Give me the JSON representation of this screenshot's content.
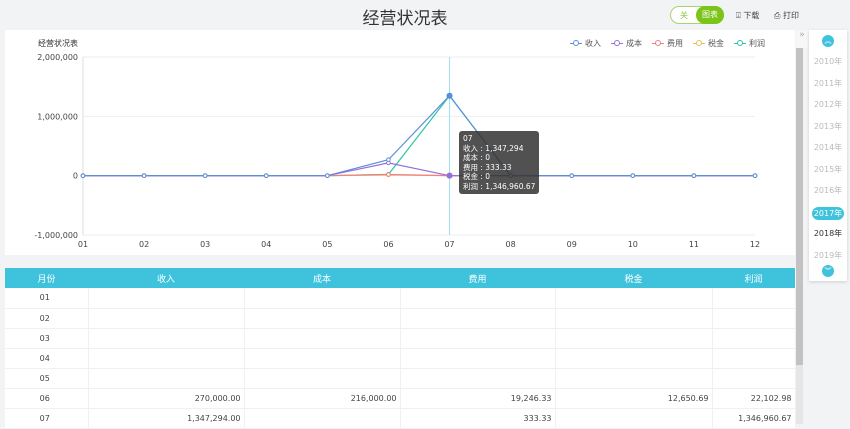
{
  "header": {
    "title": "经营状况表",
    "toggle_off": "关",
    "toggle_on": "图表",
    "download": "下载",
    "print": "打印",
    "download_icon": "download-icon",
    "print_icon": "printer-icon"
  },
  "chart_data": {
    "type": "line",
    "title": "经营状况表",
    "categories": [
      "01",
      "02",
      "03",
      "04",
      "05",
      "06",
      "07",
      "08",
      "09",
      "10",
      "11",
      "12"
    ],
    "ylim": [
      -1000000,
      2000000
    ],
    "yticks": [
      "2,000,000",
      "1,000,000",
      "0",
      "-1,000,000"
    ],
    "series": [
      {
        "name": "收入",
        "color": "#5b8fd9",
        "values": [
          0,
          0,
          0,
          0,
          0,
          270000,
          1347294,
          0,
          0,
          0,
          0,
          0
        ]
      },
      {
        "name": "成本",
        "color": "#9370db",
        "values": [
          0,
          0,
          0,
          0,
          0,
          216000,
          0,
          0,
          0,
          0,
          0,
          0
        ]
      },
      {
        "name": "费用",
        "color": "#f08080",
        "values": [
          0,
          0,
          0,
          0,
          0,
          19246.33,
          333.33,
          0,
          0,
          0,
          0,
          0
        ]
      },
      {
        "name": "税金",
        "color": "#e6c15a",
        "values": [
          0,
          0,
          0,
          0,
          0,
          12650.69,
          0,
          0,
          0,
          0,
          0,
          0
        ]
      },
      {
        "name": "利润",
        "color": "#2ec4a6",
        "values": [
          0,
          0,
          0,
          0,
          0,
          22102.98,
          1346960.67,
          0,
          0,
          0,
          0,
          0
        ]
      }
    ],
    "tooltip": {
      "title": "07",
      "lines": [
        "收入 : 1,347,294",
        "成本 : 0",
        "费用 : 333.33",
        "税金 : 0",
        "利润 : 1,346,960.67"
      ]
    }
  },
  "table": {
    "headers": [
      "月份",
      "收入",
      "成本",
      "费用",
      "税金",
      "利润"
    ],
    "rows": [
      [
        "01",
        "",
        "",
        "",
        "",
        ""
      ],
      [
        "02",
        "",
        "",
        "",
        "",
        ""
      ],
      [
        "03",
        "",
        "",
        "",
        "",
        ""
      ],
      [
        "04",
        "",
        "",
        "",
        "",
        ""
      ],
      [
        "05",
        "",
        "",
        "",
        "",
        ""
      ],
      [
        "06",
        "270,000.00",
        "216,000.00",
        "19,246.33",
        "12,650.69",
        "22,102.98"
      ],
      [
        "07",
        "1,347,294.00",
        "",
        "333.33",
        "",
        "1,346,960.67"
      ]
    ]
  },
  "years": {
    "items": [
      "2010年",
      "2011年",
      "2012年",
      "2013年",
      "2014年",
      "2015年",
      "2016年",
      "2017年",
      "2018年",
      "2019年"
    ],
    "selected": "2017年",
    "collapse": "»"
  }
}
